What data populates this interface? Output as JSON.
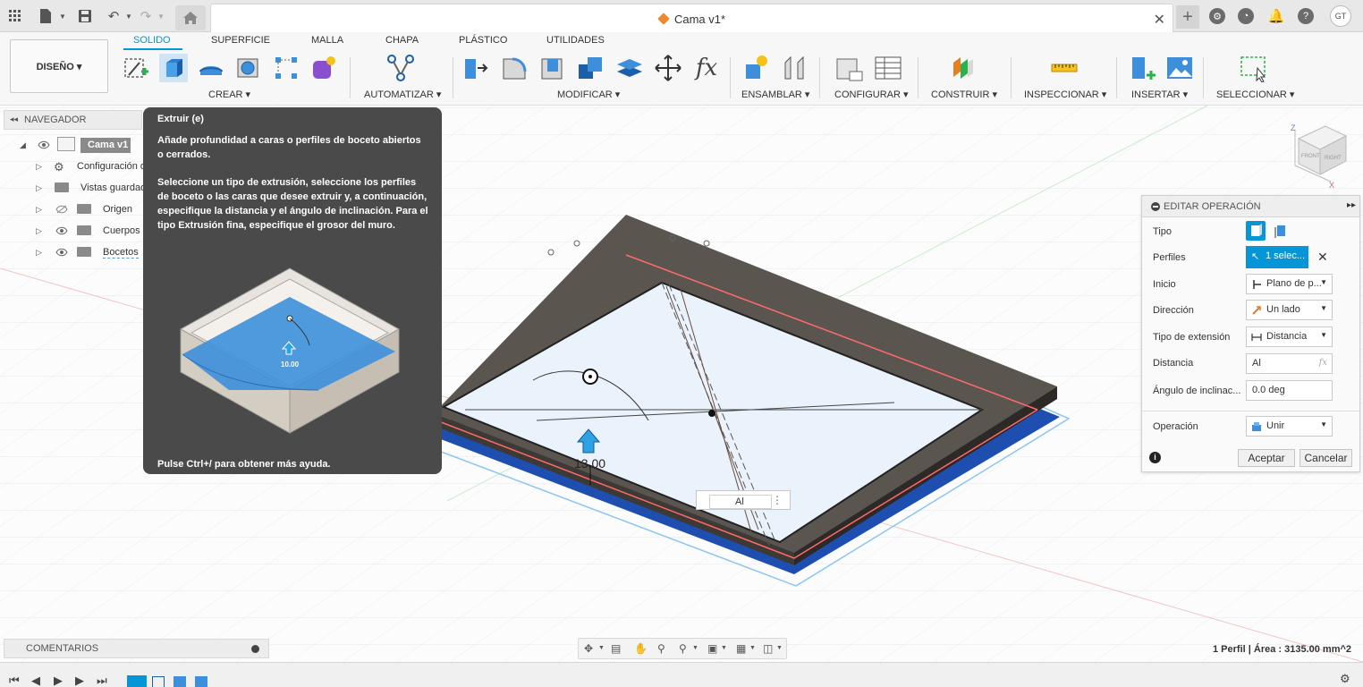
{
  "window": {
    "title": "Cama v1*"
  },
  "topbar": {
    "icons": [
      "grid-icon",
      "file-icon",
      "save-icon",
      "undo-icon",
      "redo-icon",
      "home-icon"
    ],
    "user_initials": "GT"
  },
  "ribbon": {
    "workspace": "DISEÑO ▾",
    "tabs": [
      "SOLIDO",
      "SUPERFICIE",
      "MALLA",
      "CHAPA",
      "PLÁSTICO",
      "UTILIDADES"
    ],
    "active_tab": "SOLIDO",
    "groups": [
      "CREAR ▾",
      "AUTOMATIZAR ▾",
      "MODIFICAR ▾",
      "ENSAMBLAR ▾",
      "CONFIGURAR ▾",
      "CONSTRUIR ▾",
      "INSPECCIONAR ▾",
      "INSERTAR ▾",
      "SELECCIONAR ▾"
    ]
  },
  "navigator": {
    "title": "NAVEGADOR",
    "root": "Cama v1",
    "items": [
      "Configuración d",
      "Vistas guardad",
      "Origen",
      "Cuerpos",
      "Bocetos"
    ]
  },
  "tooltip": {
    "title": "Extruir (e)",
    "p1": "Añade profundidad a caras o perfiles de boceto abiertos o cerrados.",
    "p2": "Seleccione un tipo de extrusión, seleccione los perfiles de boceto o las caras que desee extruir y, a continuación, especifique la distancia y el ángulo de inclinación. Para el tipo Extrusión fina, especifique el grosor del muro.",
    "footer": "Pulse Ctrl+/ para obtener más ayuda.",
    "image_label": "10.00"
  },
  "panel": {
    "title": "EDITAR OPERACIÓN",
    "rows": {
      "tipo": "Tipo",
      "perfiles": "Perfiles",
      "perfiles_value": "1 selec...",
      "inicio": "Inicio",
      "inicio_value": "Plano de p...",
      "direccion": "Dirección",
      "direccion_value": "Un lado",
      "tipo_ext": "Tipo de extensión",
      "tipo_ext_value": "Distancia",
      "distancia": "Distancia",
      "distancia_value": "Al",
      "angulo": "Ángulo de inclinac...",
      "angulo_value": "0.0 deg",
      "operacion": "Operación",
      "operacion_value": "Unir"
    },
    "accept": "Aceptar",
    "cancel": "Cancelar",
    "accent": "#0696d7"
  },
  "viewport": {
    "distance_label": "13.00",
    "inline_input": "Al",
    "viewcube": {
      "front": "FRONT",
      "right": "RIGHT"
    }
  },
  "comments": {
    "title": "COMENTARIOS"
  },
  "status": {
    "text": "1 Perfil | Área : 3135.00 mm^2"
  }
}
